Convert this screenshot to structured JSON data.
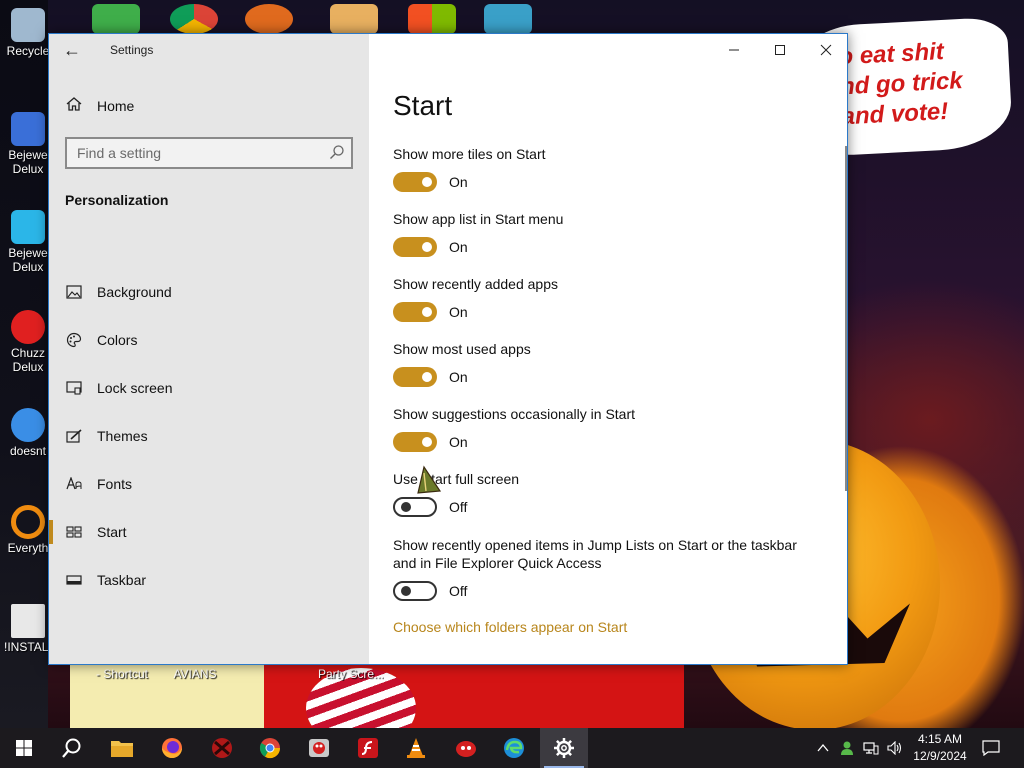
{
  "desktop": {
    "speech_bubble_lines": [
      "o eat shit",
      "nd go trick",
      "and vote!"
    ],
    "left_icons": [
      {
        "label": "Recycle",
        "name": "recycle-bin-icon",
        "color": "#9fb8cf"
      },
      {
        "label": "Bejewe",
        "sublabel": "Delux",
        "name": "bejeweled-red-icon",
        "color": "#3a6fd8"
      },
      {
        "label": "Bejewe",
        "sublabel": "Delux",
        "name": "bejeweled-blue-icon",
        "color": "#2bb6e8"
      },
      {
        "label": "Chuzz",
        "sublabel": "Delux",
        "name": "chuzzle-icon",
        "color": "#e02020"
      },
      {
        "label": "doesnt",
        "name": "thunderbird-icon",
        "color": "#3a8ee6"
      },
      {
        "label": "Everyth",
        "name": "everything-search-icon",
        "color": "#f08c10"
      },
      {
        "label": "!INSTALL",
        "name": "text-file-icon",
        "color": "#e8e8e8"
      }
    ],
    "bottom_labels": [
      "- Shortcut",
      "AVIANS",
      "Party Scre..."
    ]
  },
  "window": {
    "title": "Settings",
    "back_glyph": "←",
    "controls": {
      "minimize": "—",
      "maximize": "☐",
      "close": "✕"
    }
  },
  "sidebar": {
    "home_label": "Home",
    "search_placeholder": "Find a setting",
    "section_heading": "Personalization",
    "items": [
      {
        "label": "Background",
        "icon": "picture-icon",
        "glyph": "🖼"
      },
      {
        "label": "Colors",
        "icon": "palette-icon",
        "glyph": "🎨"
      },
      {
        "label": "Lock screen",
        "icon": "lock-screen-icon",
        "glyph": "▭"
      },
      {
        "label": "Themes",
        "icon": "themes-brush-icon",
        "glyph": "✎"
      },
      {
        "label": "Fonts",
        "icon": "fonts-icon",
        "glyph": "A"
      },
      {
        "label": "Start",
        "icon": "start-tiles-icon",
        "glyph": "▦",
        "selected": true
      },
      {
        "label": "Taskbar",
        "icon": "taskbar-icon",
        "glyph": "▬"
      }
    ]
  },
  "main": {
    "page_title": "Start",
    "settings": [
      {
        "label": "Show more tiles on Start",
        "state": "On"
      },
      {
        "label": "Show app list in Start menu",
        "state": "On"
      },
      {
        "label": "Show recently added apps",
        "state": "On"
      },
      {
        "label": "Show most used apps",
        "state": "On"
      },
      {
        "label": "Show suggestions occasionally in Start",
        "state": "On"
      },
      {
        "label": "Use Start full screen",
        "state": "Off"
      },
      {
        "label": "Show recently opened items in Jump Lists on Start or the taskbar and in File Explorer Quick Access",
        "state": "Off"
      }
    ],
    "link_label": "Choose which folders appear on Start"
  },
  "taskbar": {
    "apps": [
      {
        "name": "start-button",
        "icon": "windows-logo-icon"
      },
      {
        "name": "search-button",
        "icon": "search-icon"
      },
      {
        "name": "file-explorer-button",
        "icon": "folder-icon"
      },
      {
        "name": "firefox-button",
        "icon": "firefox-icon"
      },
      {
        "name": "red-app-button",
        "icon": "red-app-icon"
      },
      {
        "name": "chrome-button",
        "icon": "chrome-icon"
      },
      {
        "name": "game-app-button",
        "icon": "game-icon"
      },
      {
        "name": "flash-button",
        "icon": "flash-icon"
      },
      {
        "name": "vlc-button",
        "icon": "vlc-cone-icon"
      },
      {
        "name": "red-round-app-button",
        "icon": "red-round-icon"
      },
      {
        "name": "edge-button",
        "icon": "edge-icon"
      },
      {
        "name": "settings-taskbar-button",
        "icon": "gear-icon"
      }
    ],
    "clock": {
      "time": "4:15 AM",
      "date": "12/9/2024"
    },
    "colors": {
      "accent": "#c8901e",
      "link": "#b8861c"
    }
  }
}
